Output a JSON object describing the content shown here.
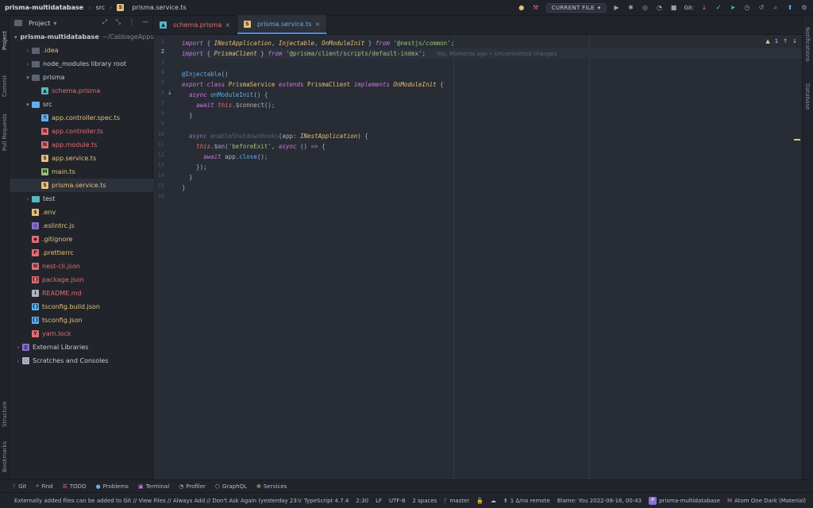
{
  "breadcrumb": {
    "project": "prisma-multidatabase",
    "folder": "src",
    "file": "prisma.service.ts"
  },
  "toolbar": {
    "run_config": "CURRENT FILE",
    "git_label": "Git:"
  },
  "left_tabs": {
    "project": "Project",
    "commit": "Commit",
    "pull_requests": "Pull Requests",
    "structure": "Structure",
    "bookmarks": "Bookmarks"
  },
  "right_tabs": {
    "notifications": "Notifications",
    "database": "Database"
  },
  "project_panel": {
    "title": "Project"
  },
  "tree": [
    {
      "label": "prisma-multidatabase",
      "suffix": "~/CabbageApps",
      "arrow": "▾",
      "kind": "root",
      "color": "#c5cad3"
    },
    {
      "label": ".idea",
      "arrow": "›",
      "kind": "folder",
      "color": "#e5c07b"
    },
    {
      "label": "node_modules  library root",
      "arrow": "›",
      "kind": "folder",
      "color": "#c5cad3"
    },
    {
      "label": "prisma",
      "arrow": "▾",
      "kind": "folder",
      "color": "#c5cad3"
    },
    {
      "label": "schema.prisma",
      "arrow": "",
      "kind": "prisma",
      "color": "#e06c75"
    },
    {
      "label": "src",
      "arrow": "▾",
      "kind": "folder-src",
      "color": "#c5cad3"
    },
    {
      "label": "app.controller.spec.ts",
      "arrow": "",
      "kind": "spec",
      "color": "#e5c07b"
    },
    {
      "label": "app.controller.ts",
      "arrow": "",
      "kind": "nest-red",
      "color": "#e06c75"
    },
    {
      "label": "app.module.ts",
      "arrow": "",
      "kind": "nest-red",
      "color": "#e06c75"
    },
    {
      "label": "app.service.ts",
      "arrow": "",
      "kind": "service",
      "color": "#e5c07b"
    },
    {
      "label": "main.ts",
      "arrow": "",
      "kind": "main",
      "color": "#e5c07b"
    },
    {
      "label": "prisma.service.ts",
      "arrow": "",
      "kind": "service",
      "color": "#e5c07b",
      "selected": true
    },
    {
      "label": "test",
      "arrow": "›",
      "kind": "folder-test",
      "color": "#c5cad3"
    },
    {
      "label": ".env",
      "arrow": "",
      "kind": "env",
      "color": "#e5c07b"
    },
    {
      "label": ".eslintrc.js",
      "arrow": "",
      "kind": "eslint",
      "color": "#e5c07b"
    },
    {
      "label": ".gitignore",
      "arrow": "",
      "kind": "git",
      "color": "#e5c07b"
    },
    {
      "label": ".prettierrc",
      "arrow": "",
      "kind": "prettier",
      "color": "#e5c07b"
    },
    {
      "label": "nest-cli.json",
      "arrow": "",
      "kind": "nest",
      "color": "#e06c75"
    },
    {
      "label": "package.json",
      "arrow": "",
      "kind": "json",
      "color": "#e06c75"
    },
    {
      "label": "README.md",
      "arrow": "",
      "kind": "md",
      "color": "#e06c75"
    },
    {
      "label": "tsconfig.build.json",
      "arrow": "",
      "kind": "tsjson",
      "color": "#e5c07b"
    },
    {
      "label": "tsconfig.json",
      "arrow": "",
      "kind": "tsjson",
      "color": "#e5c07b"
    },
    {
      "label": "yarn.lock",
      "arrow": "",
      "kind": "lock",
      "color": "#e06c75"
    },
    {
      "label": "External Libraries",
      "arrow": "›",
      "kind": "lib",
      "color": "#c5cad3"
    },
    {
      "label": "Scratches and Consoles",
      "arrow": "›",
      "kind": "scratch",
      "color": "#c5cad3"
    }
  ],
  "tabs": [
    {
      "label": "schema.prisma",
      "active": false
    },
    {
      "label": "prisma.service.ts",
      "active": true
    }
  ],
  "editor": {
    "warning_count": "1",
    "git_hint": "You, Moments ago • Uncommitted changes"
  },
  "tool_windows": [
    "Git",
    "Find",
    "TODO",
    "Problems",
    "Terminal",
    "Profiler",
    "GraphQL",
    "Services"
  ],
  "status": {
    "message": "Externally added files can be added to Git // View Files // Always Add // Don't Ask Again (yesterday 23:15)",
    "language": "TypeScript 4.7.4",
    "position": "2:30",
    "line_ending": "LF",
    "encoding": "UTF-8",
    "indent": "2 spaces",
    "branch": "master",
    "remote": "1 Δ/no remote",
    "blame": "Blame: You 2022-08-16, 00:43",
    "project": "prisma-multidatabase",
    "theme": "Atom One Dark (Material)"
  }
}
